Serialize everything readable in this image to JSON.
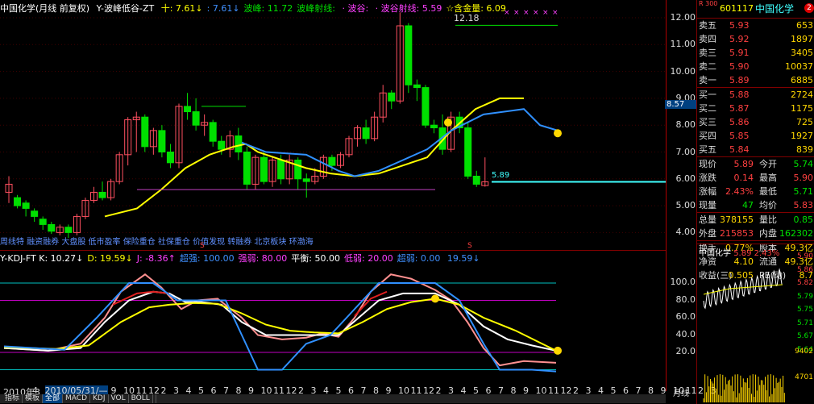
{
  "main_header": {
    "title": "中国化学(月线 前复权)",
    "indicator": "Y-波峰低谷-ZT",
    "items": [
      {
        "label": "十:",
        "value": "7.61",
        "arrow": "↓",
        "color": "#ffff00"
      },
      {
        "label": ":",
        "value": "7.61",
        "arrow": "↓",
        "color": "#4090ff"
      },
      {
        "label": "波峰:",
        "value": "11.72",
        "color": "#00e000"
      },
      {
        "label": "波峰射线:",
        "value": "",
        "color": "#00e000"
      },
      {
        "label": "· 波谷:",
        "value": "",
        "color": "#ff40ff"
      },
      {
        "label": "· 波谷射线:",
        "value": "5.59",
        "color": "#ff40ff"
      },
      {
        "label": "☆含金量:",
        "value": "6.09",
        "color": "#ffff00"
      }
    ]
  },
  "main_chart": {
    "peak_label": "12.18",
    "last_price_label": "5.89",
    "right_marker": "8.57",
    "bottom_text": "周线特 融资融券 大盘股 低市盈率 保险重仓 社保重仓 价值发现 转融券 北京板块 环渤海",
    "signal_marks": [
      "S",
      "S"
    ],
    "price_ticks": [
      "12.00",
      "11.00",
      "10.00",
      "9.00",
      "8.00",
      "7.00",
      "6.00",
      "5.00",
      "4.00"
    ]
  },
  "kdj_header": {
    "title": "Y-KDJ-FT",
    "items": [
      {
        "label": "K:",
        "value": "10.27",
        "arrow": "↓",
        "color": "#ffffff"
      },
      {
        "label": "D:",
        "value": "19.59",
        "arrow": "↓",
        "color": "#ffff00"
      },
      {
        "label": "J:",
        "value": "-8.36",
        "arrow": "↑",
        "color": "#ff40ff"
      },
      {
        "label": "超强:",
        "value": "100.00",
        "color": "#4090ff"
      },
      {
        "label": "强弱:",
        "value": "80.00",
        "color": "#ff40ff"
      },
      {
        "label": "平衡:",
        "value": "50.00",
        "color": "#ffffff"
      },
      {
        "label": "低弱:",
        "value": "20.00",
        "color": "#ff40ff"
      },
      {
        "label": "超弱:",
        "value": "0.00",
        "color": "#4090ff"
      },
      {
        "label": "",
        "value": "19.59",
        "arrow": "↓",
        "color": "#4090ff"
      }
    ],
    "ticks": [
      "100.0",
      "80.0",
      "60.0",
      "40.0",
      "20.0"
    ]
  },
  "date_axis": [
    "2010年3",
    "4",
    "2010/05/31/—",
    "9",
    "10",
    "11",
    "12",
    "2",
    "3",
    "4",
    "5",
    "6",
    "7",
    "8",
    "9",
    "10",
    "11",
    "12",
    "2",
    "3",
    "4",
    "5",
    "6",
    "7",
    "8",
    "9",
    "10",
    "11",
    "12",
    "2",
    "3",
    "4",
    "5",
    "6",
    "7",
    "8",
    "9",
    "10",
    "11",
    "12",
    "2",
    "3",
    "4",
    "5",
    "6",
    "7",
    "8",
    "9",
    "10",
    "11",
    "2",
    "3"
  ],
  "tabs": [
    "指标",
    "模板",
    "全部",
    "MACD",
    "KDJ",
    "VOL",
    "BOLL"
  ],
  "tabs_active": 2,
  "quote": {
    "code": "601117",
    "name": "中国化学",
    "badge": "R 300",
    "sell": [
      {
        "label": "卖五",
        "price": "5.93",
        "vol": "653"
      },
      {
        "label": "卖四",
        "price": "5.92",
        "vol": "1897"
      },
      {
        "label": "卖三",
        "price": "5.91",
        "vol": "3405"
      },
      {
        "label": "卖二",
        "price": "5.90",
        "vol": "10037"
      },
      {
        "label": "卖一",
        "price": "5.89",
        "vol": "6885"
      }
    ],
    "buy": [
      {
        "label": "买一",
        "price": "5.88",
        "vol": "2724"
      },
      {
        "label": "买二",
        "price": "5.87",
        "vol": "1175"
      },
      {
        "label": "买三",
        "price": "5.86",
        "vol": "725"
      },
      {
        "label": "买四",
        "price": "5.85",
        "vol": "1927"
      },
      {
        "label": "买五",
        "price": "5.84",
        "vol": "839"
      }
    ],
    "stats": [
      {
        "l1": "现价",
        "v1": "5.89",
        "c1": "#ff4040",
        "l2": "今开",
        "v2": "5.74",
        "c2": "#00e000"
      },
      {
        "l1": "涨跌",
        "v1": "0.14",
        "c1": "#ff4040",
        "l2": "最高",
        "v2": "5.90",
        "c2": "#ff4040"
      },
      {
        "l1": "涨幅",
        "v1": "2.43%",
        "c1": "#ff4040",
        "l2": "最低",
        "v2": "5.71",
        "c2": "#00e000"
      },
      {
        "l1": "现量",
        "v1": "47",
        "c1": "#00e000",
        "l2": "均价",
        "v2": "5.83",
        "c2": "#ff4040"
      }
    ],
    "stats2": [
      {
        "l1": "总量",
        "v1": "378155",
        "c1": "#ffd700",
        "l2": "量比",
        "v2": "0.85",
        "c2": "#00e000"
      },
      {
        "l1": "外盘",
        "v1": "215853",
        "c1": "#ff4040",
        "l2": "内盘",
        "v2": "162302",
        "c2": "#00e000"
      }
    ],
    "stats3": [
      {
        "l1": "换手",
        "v1": "0.77%",
        "c1": "#ffd700",
        "l2": "股本",
        "v2": "49.3亿",
        "c2": "#ffd700"
      },
      {
        "l1": "净资",
        "v1": "4.10",
        "c1": "#ffd700",
        "l2": "流通",
        "v2": "49.3亿",
        "c2": "#ffd700"
      },
      {
        "l1": "收益(三)",
        "v1": "0.505",
        "c1": "#ffd700",
        "l2": "PE(动)",
        "v2": "8.7",
        "c2": "#ffd700"
      }
    ]
  },
  "mini_chart": {
    "title": "中国化学",
    "price": "5.89",
    "pct": "2.43%",
    "ticks_right": [
      "5.90",
      "5.86",
      "5.82",
      "5.79",
      "5.75",
      "5.71",
      "5.67",
      "5.64",
      "9402",
      "4701"
    ],
    "label": "月线"
  }
}
